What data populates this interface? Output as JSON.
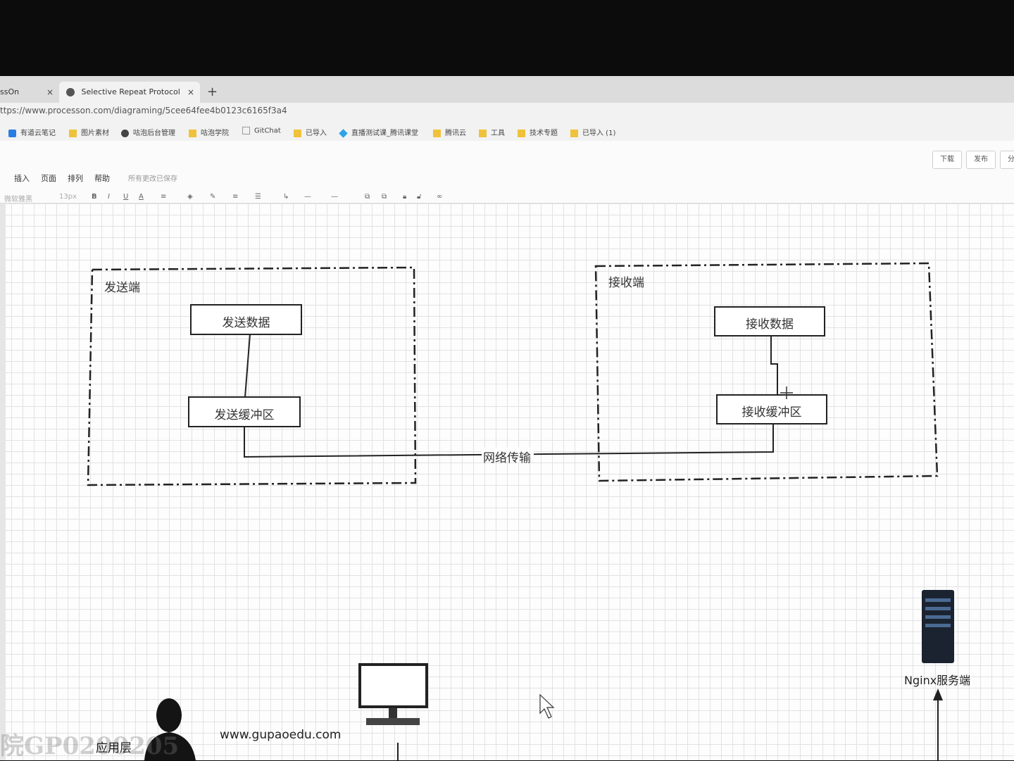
{
  "browser": {
    "tabs": [
      {
        "label": "ssOn"
      },
      {
        "label": "Selective Repeat Protocol"
      }
    ],
    "new_tab": "+",
    "close_glyph": "×",
    "url": "ttps://www.processon.com/diagraming/5cee64fee4b0123c6165f3a4",
    "bookmarks": [
      {
        "label": "有道云笔记",
        "icon": "note-icon"
      },
      {
        "label": "图片素材",
        "icon": "folder-icon"
      },
      {
        "label": "咕泡后台管理",
        "icon": "globe-icon"
      },
      {
        "label": "咕泡学院",
        "icon": "folder-icon"
      },
      {
        "label": "GitChat",
        "icon": "page-icon"
      },
      {
        "label": "已导入",
        "icon": "folder-icon"
      },
      {
        "label": "直播测试课_腾讯课堂",
        "icon": "diamond-icon"
      },
      {
        "label": "腾讯云",
        "icon": "folder-icon"
      },
      {
        "label": "工具",
        "icon": "folder-icon"
      },
      {
        "label": "技术专题",
        "icon": "folder-icon"
      },
      {
        "label": "已导入 (1)",
        "icon": "folder-icon"
      }
    ]
  },
  "app": {
    "header_buttons": {
      "download": "下载",
      "publish": "发布",
      "share": "分"
    },
    "menu": [
      "插入",
      "页面",
      "排列",
      "帮助"
    ],
    "save_status": "所有更改已保存",
    "font_select": "微软雅黑",
    "size_select": "13px",
    "format_tools": [
      "B",
      "I",
      "U",
      "A"
    ]
  },
  "diagram": {
    "sender_group": "发送端",
    "receiver_group": "接收端",
    "send_data": "发送数据",
    "send_buffer": "发送缓冲区",
    "recv_data": "接收数据",
    "recv_buffer": "接收缓冲区",
    "network": "网络传输",
    "nginx": "Nginx服务端",
    "app_layer": "应用层",
    "website": "www.gupaoedu.com",
    "watermark": "院GP0200205"
  }
}
